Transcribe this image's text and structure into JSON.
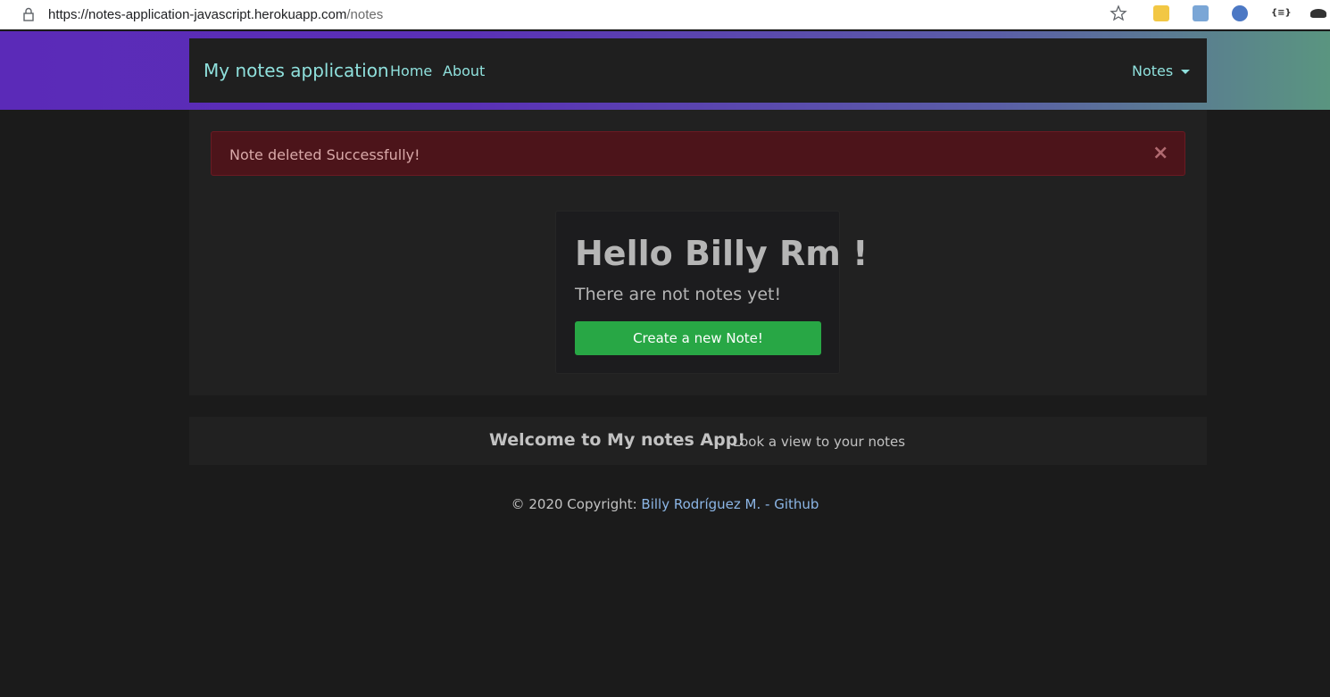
{
  "browser": {
    "url_host": "https://notes-application-javascript.herokuapp.com",
    "url_path": "/notes",
    "icons": [
      "lock-icon",
      "bookmark-star-icon",
      "translate-extension-icon",
      "translate-image-extension-icon",
      "compass-extension-icon",
      "json-extension-icon",
      "hat-extension-icon"
    ]
  },
  "navbar": {
    "brand": "My notes application",
    "links": [
      "Home",
      "About"
    ],
    "dropdown_label": "Notes"
  },
  "alert": {
    "message": "Note deleted Successfully!",
    "close_symbol": "×"
  },
  "card": {
    "title": "Hello Billy Rm !",
    "subtitle": "There are not notes yet!",
    "button_label": "Create a new Note!"
  },
  "welcome": {
    "title": "Welcome to My notes App!",
    "subtitle": "Look a view to your notes"
  },
  "footer": {
    "copyright": "© 2020 Copyright: ",
    "author_link": "Billy Rodríguez M. - Github"
  },
  "colors": {
    "background": "#1b1b1b",
    "navbar": "#1f1f1f",
    "accent_text": "#8fe0dc",
    "alert_bg": "#4c141a",
    "button_green": "#28a745",
    "link_blue": "#8cb6e6",
    "gradient_start": "#5b2ab8",
    "gradient_end": "#5a9580"
  }
}
